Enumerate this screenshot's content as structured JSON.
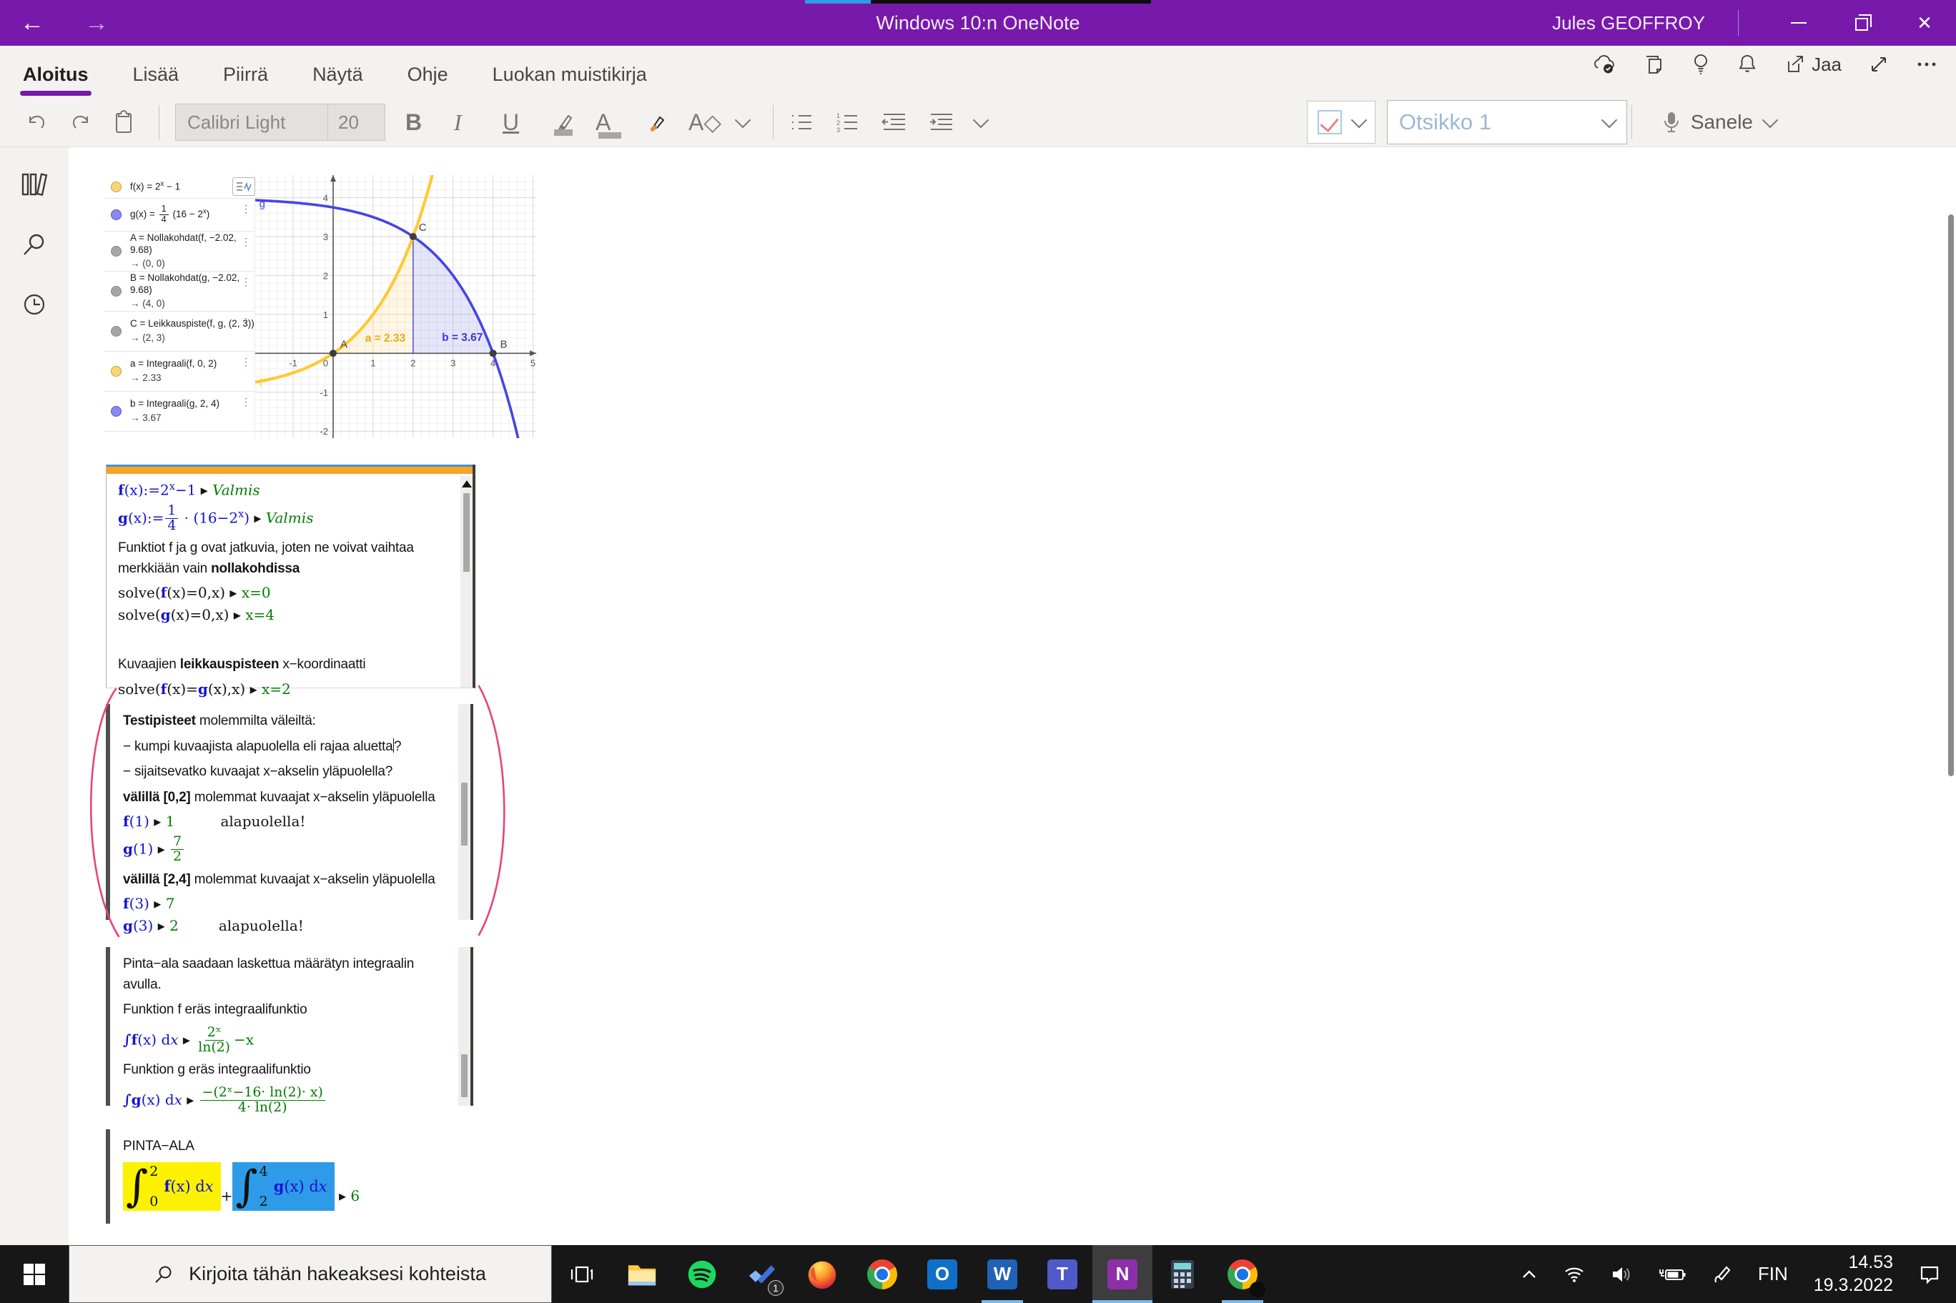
{
  "window": {
    "title": "Windows 10:n OneNote",
    "user": "Jules GEOFFROY"
  },
  "ribbon": {
    "tabs": [
      {
        "label": "Aloitus",
        "active": true
      },
      {
        "label": "Lisää",
        "active": false
      },
      {
        "label": "Piirrä",
        "active": false
      },
      {
        "label": "Näytä",
        "active": false
      },
      {
        "label": "Ohje",
        "active": false
      },
      {
        "label": "Luokan muistikirja",
        "active": false
      }
    ],
    "share_label": "Jaa",
    "toolbar": {
      "font_name": "Calibri Light",
      "font_size": "20",
      "style_name": "Otsikko 1",
      "dictate_label": "Sanele"
    }
  },
  "geogebra": {
    "algebra_rows": [
      {
        "dot": "#F6D679",
        "dot_border": "#C8A135",
        "segs": [
          {
            "t": "f(x) = 2"
          },
          {
            "sup": "x"
          },
          {
            "t": " − 1"
          }
        ],
        "button": true,
        "h": 33
      },
      {
        "dot": "#8989F0",
        "dot_border": "#5353CC",
        "segs": [
          {
            "t": "g(x) = "
          },
          {
            "frac": [
              "1",
              "4"
            ]
          },
          {
            "t": " (16 − 2"
          },
          {
            "sup": "x"
          },
          {
            "t": ")"
          }
        ],
        "kebab": true,
        "h": 46
      },
      {
        "dot": "#A6A6A6",
        "dot_border": "#8a8a8a",
        "segs": [
          {
            "t": "A = Nollakohdat(f, −2.02, 9.68)"
          }
        ],
        "result": "→ (0, 0)",
        "kebab": true,
        "h": 56
      },
      {
        "dot": "#A6A6A6",
        "dot_border": "#8a8a8a",
        "segs": [
          {
            "t": "B = Nollakohdat(g, −2.02, 9.68)"
          }
        ],
        "result": "→ (4, 0)",
        "kebab": true,
        "h": 56
      },
      {
        "dot": "#A6A6A6",
        "dot_border": "#8a8a8a",
        "segs": [
          {
            "t": "C = Leikkauspiste(f, g, (2, 3))"
          }
        ],
        "result": "→ (2, 3)",
        "kebab": true,
        "h": 56
      },
      {
        "dot": "#F6D679",
        "dot_border": "#C8A135",
        "segs": [
          {
            "t": "a = Integraali(f, 0, 2)"
          }
        ],
        "result": "→ 2.33",
        "kebab": true,
        "h": 56
      },
      {
        "dot": "#8989F0",
        "dot_border": "#5353CC",
        "segs": [
          {
            "t": "b = Integraali(g, 2, 4)"
          }
        ],
        "result": "→ 3.67",
        "kebab": true,
        "h": 56
      }
    ]
  },
  "chart_data": {
    "type": "line",
    "functions": [
      {
        "name": "f",
        "expr": "2^x − 1",
        "js": "Math.pow(2,x)-1",
        "color": "#FFC933",
        "width": 4.2,
        "label_pos": [
          -1.85,
          -0.85
        ]
      },
      {
        "name": "g",
        "expr": "(1/4)(16 − 2^x)",
        "js": "0.25*(16-Math.pow(2,x))",
        "color": "#4545E6",
        "width": 3.6,
        "label_pos": [
          -1.85,
          3.75
        ]
      }
    ],
    "points": [
      {
        "label": "A",
        "x": 0,
        "y": 0,
        "label_offset": [
          10,
          -8
        ]
      },
      {
        "label": "B",
        "x": 4,
        "y": 0,
        "label_offset": [
          10,
          -8
        ]
      },
      {
        "label": "C",
        "x": 2,
        "y": 3,
        "label_offset": [
          8,
          -8
        ]
      }
    ],
    "regions": [
      {
        "label": "a = 2.33",
        "under": "f",
        "from": 0,
        "to": 2,
        "fill": "rgba(255,204,80,0.16)",
        "edge": "#FFC94F",
        "label_color": "#E7AE13",
        "label_pos": [
          0.8,
          0.3
        ]
      },
      {
        "label": "b = 3.67",
        "under": "g",
        "from": 2,
        "to": 4,
        "fill": "rgba(90,90,230,0.15)",
        "edge": "#4545E6",
        "label_color": "#3A3AD0",
        "label_pos": [
          2.72,
          0.32
        ]
      }
    ],
    "xlim": [
      -1.95,
      5.08
    ],
    "ylim": [
      -2.18,
      4.58
    ],
    "xticks": [
      -1,
      1,
      2,
      3,
      4,
      5
    ],
    "yticks": [
      -2,
      -1,
      1,
      2,
      3,
      4
    ],
    "origin_label": "0",
    "grid": true
  },
  "notes": {
    "block1": {
      "lines": [
        {
          "kind": "math",
          "segs": [
            {
              "t": "f",
              "c": "blue",
              "b": true
            },
            {
              "t": "(x):=2",
              "c": "blue"
            },
            {
              "sup": "x",
              "c": "blue"
            },
            {
              "t": "−1",
              "c": "blue"
            },
            {
              "t": "  ▸  "
            },
            {
              "t": "Valmis",
              "c": "green",
              "i": true
            }
          ]
        },
        {
          "kind": "math",
          "segs": [
            {
              "t": "g",
              "c": "blue",
              "b": true
            },
            {
              "t": "(x):=",
              "c": "blue"
            },
            {
              "frac": [
                "1",
                "4"
              ],
              "c": "blue"
            },
            {
              "t": " · (16−2",
              "c": "blue"
            },
            {
              "sup": "x",
              "c": "blue"
            },
            {
              "t": ")",
              "c": "blue"
            },
            {
              "t": "  ▸  "
            },
            {
              "t": "Valmis",
              "c": "green",
              "i": true
            }
          ]
        },
        {
          "kind": "text",
          "segs": [
            {
              "t": "Funktiot f ja g ovat jatkuvia, joten ne voivat vaihtaa merkkiään vain "
            },
            {
              "t": "nollakohdissa",
              "b": true
            }
          ]
        },
        {
          "kind": "math",
          "segs": [
            {
              "t": "solve("
            },
            {
              "t": "f",
              "c": "blue",
              "b": true
            },
            {
              "t": "(x)=0,x)"
            },
            {
              "t": "  ▸  "
            },
            {
              "t": "x=0",
              "c": "green"
            }
          ]
        },
        {
          "kind": "math",
          "segs": [
            {
              "t": "solve("
            },
            {
              "t": "g",
              "c": "blue",
              "b": true
            },
            {
              "t": "(x)=0,x)"
            },
            {
              "t": "  ▸  "
            },
            {
              "t": "x=4",
              "c": "green"
            }
          ]
        },
        {
          "kind": "spacer"
        },
        {
          "kind": "text",
          "segs": [
            {
              "t": "Kuvaajien "
            },
            {
              "t": "leikkauspisteen",
              "b": true
            },
            {
              "t": " x−koordinaatti"
            }
          ]
        },
        {
          "kind": "math",
          "segs": [
            {
              "t": "solve("
            },
            {
              "t": "f",
              "c": "blue",
              "b": true
            },
            {
              "t": "(x)="
            },
            {
              "t": "g",
              "c": "blue",
              "b": true
            },
            {
              "t": "(x),x)"
            },
            {
              "t": "  ▸  "
            },
            {
              "t": "x=2",
              "c": "green"
            }
          ]
        }
      ]
    },
    "block2": {
      "lines": [
        {
          "kind": "text",
          "segs": [
            {
              "t": "Testipisteet",
              "b": true
            },
            {
              "t": " molemmilta väleiltä:"
            }
          ]
        },
        {
          "kind": "text",
          "segs": [
            {
              "t": "− kumpi kuvaajista alapuolella eli rajaa aluetta"
            },
            {
              "caret": true
            },
            {
              "t": "?"
            }
          ]
        },
        {
          "kind": "text",
          "segs": [
            {
              "t": "− sijaitsevatko kuvaajat x−akselin yläpuolella?"
            }
          ]
        },
        {
          "kind": "text",
          "segs": [
            {
              "t": "välillä [0,2]",
              "b": true
            },
            {
              "t": " molemmat kuvaajat x−akselin yläpuolella"
            }
          ]
        },
        {
          "kind": "math",
          "segs": [
            {
              "t": "f",
              "c": "blue",
              "b": true
            },
            {
              "t": "(1)",
              "c": "blue"
            },
            {
              "t": " ▸ "
            },
            {
              "t": "1",
              "c": "green"
            },
            {
              "sp": 3.2
            },
            {
              "t": "alapuolella!"
            }
          ]
        },
        {
          "kind": "math",
          "segs": [
            {
              "t": "g",
              "c": "blue",
              "b": true
            },
            {
              "t": "(1)",
              "c": "blue"
            },
            {
              "t": " ▸ "
            },
            {
              "frac": [
                "7",
                "2"
              ],
              "c": "green"
            }
          ]
        },
        {
          "kind": "text",
          "segs": [
            {
              "t": "välillä [2,4]",
              "b": true
            },
            {
              "t": " molemmat kuvaajat x−akselin yläpuolella"
            }
          ]
        },
        {
          "kind": "math",
          "segs": [
            {
              "t": "f",
              "c": "blue",
              "b": true
            },
            {
              "t": "(3)",
              "c": "blue"
            },
            {
              "t": " ▸ "
            },
            {
              "t": "7",
              "c": "green"
            }
          ]
        },
        {
          "kind": "math",
          "segs": [
            {
              "t": "g",
              "c": "blue",
              "b": true
            },
            {
              "t": "(3)",
              "c": "blue"
            },
            {
              "t": " ▸ "
            },
            {
              "t": "2",
              "c": "green"
            },
            {
              "sp": 2.8
            },
            {
              "t": "alapuolella!"
            }
          ]
        }
      ]
    },
    "block3": {
      "lines": [
        {
          "kind": "text",
          "segs": [
            {
              "t": "Pinta−ala saadaan laskettua määrätyn integraalin avulla."
            }
          ]
        },
        {
          "kind": "text",
          "segs": [
            {
              "t": "Funktion f eräs integraalifunktio"
            }
          ]
        },
        {
          "kind": "math",
          "segs": [
            {
              "t": "∫",
              "c": "blue",
              "b": true
            },
            {
              "t": "f",
              "c": "blue",
              "b": true
            },
            {
              "t": "(x) d",
              "c": "blue"
            },
            {
              "t": "x",
              "c": "blue",
              "i": true
            },
            {
              "t": "  ▸  "
            },
            {
              "frac": [
                "2ˣ",
                "ln(2)"
              ],
              "c": "green"
            },
            {
              "t": "−x",
              "c": "green"
            }
          ]
        },
        {
          "kind": "text",
          "segs": [
            {
              "t": "Funktion g eräs integraalifunktio"
            }
          ]
        },
        {
          "kind": "math",
          "segs": [
            {
              "t": "∫",
              "c": "blue",
              "b": true
            },
            {
              "t": "g",
              "c": "blue",
              "b": true
            },
            {
              "t": "(x) d",
              "c": "blue"
            },
            {
              "t": "x",
              "c": "blue",
              "i": true
            },
            {
              "t": "  ▸  "
            },
            {
              "frac": [
                "−(2ˣ−16· ln(2)· x)",
                "4· ln(2)"
              ],
              "c": "green"
            }
          ]
        }
      ]
    },
    "block4": {
      "lines": [
        {
          "kind": "text",
          "segs": [
            {
              "t": "PINTA−ALA"
            }
          ]
        },
        {
          "kind": "math",
          "segs": [
            {
              "int": {
                "top": "2",
                "bot": "0",
                "segs": [
                  {
                    "t": "f",
                    "c": "blue",
                    "b": true
                  },
                  {
                    "t": "(x) d",
                    "c": "blue"
                  },
                  {
                    "t": "x",
                    "c": "blue",
                    "i": true
                  }
                ]
              },
              "hl": "#FCF200"
            },
            {
              "t": "+"
            },
            {
              "int": {
                "top": "4",
                "bot": "2",
                "segs": [
                  {
                    "t": "g",
                    "c": "blue",
                    "b": true
                  },
                  {
                    "t": "(x) d",
                    "c": "blue"
                  },
                  {
                    "t": "x",
                    "c": "blue",
                    "i": true
                  }
                ]
              },
              "hl": "#2E9BE8"
            },
            {
              "t": " ▸ "
            },
            {
              "t": "6",
              "c": "green"
            }
          ]
        }
      ]
    }
  },
  "taskbar": {
    "search_placeholder": "Kirjoita tähän hakeaksesi kohteista",
    "apps": [
      {
        "name": "file-explorer",
        "kind": "explorer"
      },
      {
        "name": "spotify",
        "kind": "spotify"
      },
      {
        "name": "todo",
        "kind": "todo",
        "badge": "1"
      },
      {
        "name": "firefox",
        "kind": "firefox"
      },
      {
        "name": "chrome",
        "kind": "chrome"
      },
      {
        "name": "outlook",
        "kind": "outlook",
        "letter": "O",
        "color": "#1070C8"
      },
      {
        "name": "word",
        "kind": "word",
        "letter": "W",
        "color": "#2062B8",
        "open": true
      },
      {
        "name": "teams",
        "kind": "teams",
        "letter": "T",
        "color": "#5059C9"
      },
      {
        "name": "onenote",
        "kind": "onenote",
        "letter": "N",
        "color": "#8C2FA8",
        "open": true,
        "active": true
      },
      {
        "name": "calculator",
        "kind": "calculator"
      },
      {
        "name": "chrome-profile",
        "kind": "chrome",
        "open": true,
        "dark_badge": true
      }
    ],
    "tray": {
      "lang": "FIN",
      "time": "14.53",
      "date": "19.3.2022"
    }
  }
}
